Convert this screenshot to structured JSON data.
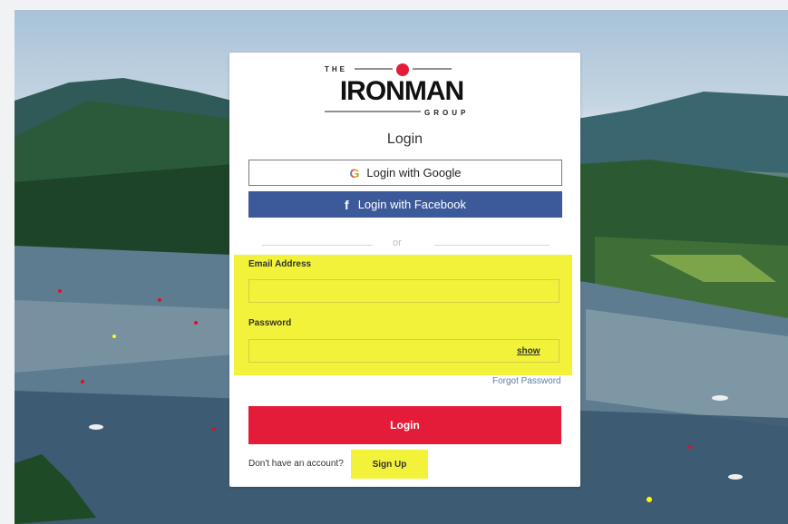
{
  "brand": {
    "line1": "THE",
    "name": "IRONMAN",
    "suffix": "GROUP"
  },
  "form": {
    "title": "Login",
    "google_label": "Login with Google",
    "facebook_label": "Login with Facebook",
    "divider_text": "or",
    "email_label": "Email Address",
    "email_value": "",
    "password_label": "Password",
    "password_value": "",
    "show_label": "show",
    "forgot_label": "Forgot Password",
    "login_label": "Login",
    "no_account_text": "Don't have an account?",
    "signup_label": "Sign Up"
  },
  "colors": {
    "login_button": "#e51b3a",
    "facebook_button": "#3c5a9a",
    "highlight": "#f2f23a",
    "forgot_link": "#5a7fa8"
  },
  "icons": {
    "google": "google-g-icon",
    "facebook": "facebook-f-icon"
  }
}
